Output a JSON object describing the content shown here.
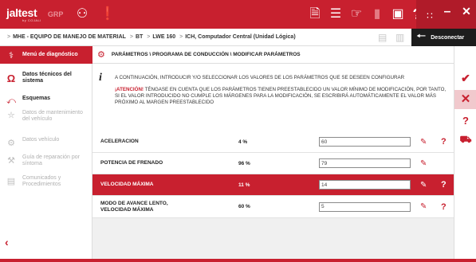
{
  "app": {
    "brand": "jaltest",
    "brand_sub": "by COJALI",
    "module": "GRP"
  },
  "toolbar": {
    "icons": [
      "truck-group-icon",
      "alert-icon",
      "document-icon",
      "list-icon",
      "hand-icon",
      "battery-icon",
      "camera-icon",
      "help-icon",
      "grid-icon"
    ],
    "help_label": "?",
    "alert_label": "!"
  },
  "window": {
    "minimize": "–",
    "maximize": "□",
    "close": "✕"
  },
  "breadcrumb": {
    "items": [
      "MHE - EQUIPO DE MANEJO DE MATERIAL",
      "BT",
      "LWE 160",
      "ICH, Computador Central (Unidad Lógica)"
    ]
  },
  "disconnect_label": "Desconectar",
  "sidebar": {
    "items": [
      {
        "label": "Menú de diagnóstico",
        "icon": "stethoscope-icon",
        "active": true,
        "disabled": false
      },
      {
        "label": "Datos técnicos del sistema",
        "icon": "ohm-icon",
        "active": false,
        "disabled": false
      },
      {
        "label": "Esquemas",
        "icon": "schematic-icon",
        "active": false,
        "disabled": false
      },
      {
        "label": "Datos de mantenimiento del vehículo",
        "icon": "oil-can-icon",
        "active": false,
        "disabled": true
      },
      {
        "label": "Datos vehículo",
        "icon": "wrench-icon",
        "active": false,
        "disabled": true
      },
      {
        "label": "Guía de reparación por síntoma",
        "icon": "repair-icon",
        "active": false,
        "disabled": true
      },
      {
        "label": "Comunicados y Procedimientos",
        "icon": "document-stack-icon",
        "active": false,
        "disabled": true
      }
    ],
    "back_label": "‹"
  },
  "panel": {
    "title": "PARÁMETROS \\ PROGRAMA DE CONDUCCIÓN \\ MODIFICAR PARÁMETROS",
    "info_line": "A CONTINUACIÓN, INTRODUCIR Y/O SELECCIONAR LOS VALORES DE LOS PARÁMETROS QUE SE DESEEN CONFIGURAR",
    "warning_label": "¡ATENCIÓN!",
    "warning_text": " TÉNGASE EN CUENTA QUE LOS PARÁMETROS TIENEN PREESTABLECIDO UN VALOR MÍNIMO DE MODIFICACIÓN, POR TANTO, SI EL VALOR INTRODUCIDO NO CUMPLE LOS MÁRGENES PARA LA MODIFICACIÓN, SE ESCRIBIRÁ AUTOMÁTICAMENTE EL VALOR MÁS PRÓXIMO AL MARGEN PREESTABLECIDO"
  },
  "parameters": [
    {
      "name": "ACELERACION",
      "current": "4 %",
      "input": "60",
      "has_help": true,
      "selected": false
    },
    {
      "name": "POTENCIA DE FRENADO",
      "current": "96 %",
      "input": "79",
      "has_help": false,
      "selected": false
    },
    {
      "name": "VELOCIDAD MÁXIMA",
      "current": "11 %",
      "input": "14",
      "has_help": true,
      "selected": true
    },
    {
      "name": "MODO DE AVANCE LENTO, VELOCIDAD MÁXIMA",
      "current": "60 %",
      "input": "5",
      "has_help": true,
      "selected": false
    }
  ],
  "actions": {
    "accept": "✔",
    "cancel": "✕",
    "help": "?"
  },
  "colors": {
    "accent": "#c8202f",
    "dark": "#1d1d1d"
  }
}
